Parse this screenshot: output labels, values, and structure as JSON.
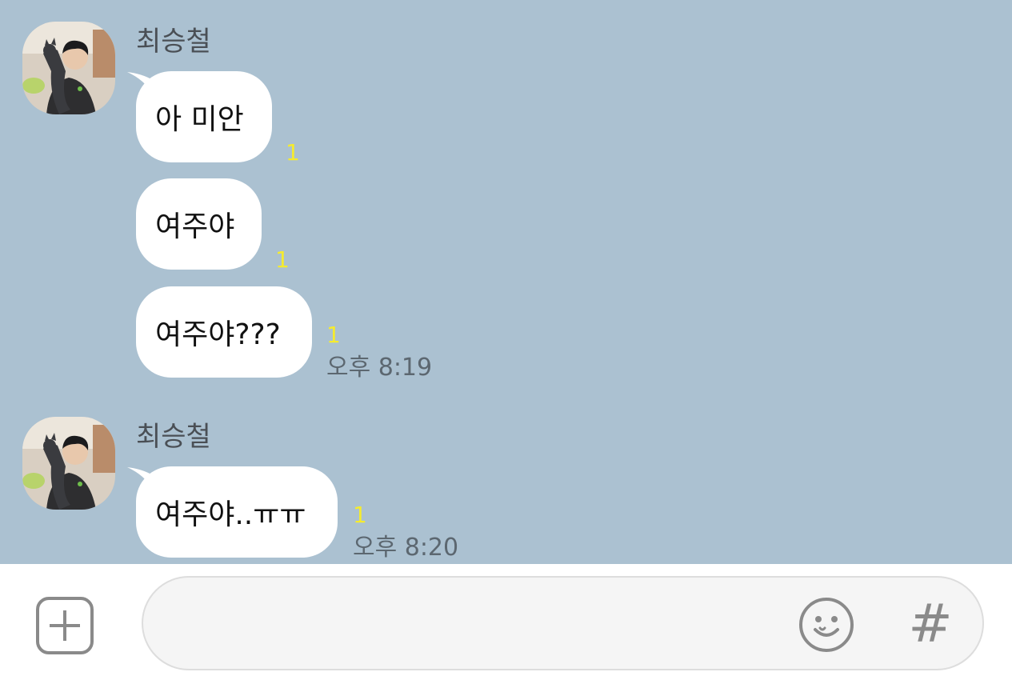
{
  "messages": [
    {
      "sender": "최승철",
      "bubbles": [
        {
          "text": "아 미안",
          "unread": "1",
          "time": ""
        },
        {
          "text": "여주야",
          "unread": "1",
          "time": ""
        },
        {
          "text": "여주야???",
          "unread": "1",
          "time": "오후 8:19"
        }
      ]
    },
    {
      "sender": "최승철",
      "bubbles": [
        {
          "text": "여주야..ㅠㅠ",
          "unread": "1",
          "time": "오후 8:20"
        }
      ]
    }
  ],
  "input_bar": {
    "message_value": "",
    "plus_icon": "plus-square-icon",
    "emoji_icon": "smiley-face-icon",
    "hash_label": "#"
  },
  "colors": {
    "chat_background": "#abc1d1",
    "bubble": "#ffffff",
    "unread_count": "#f5eb2f",
    "timestamp": "#5c6770"
  }
}
